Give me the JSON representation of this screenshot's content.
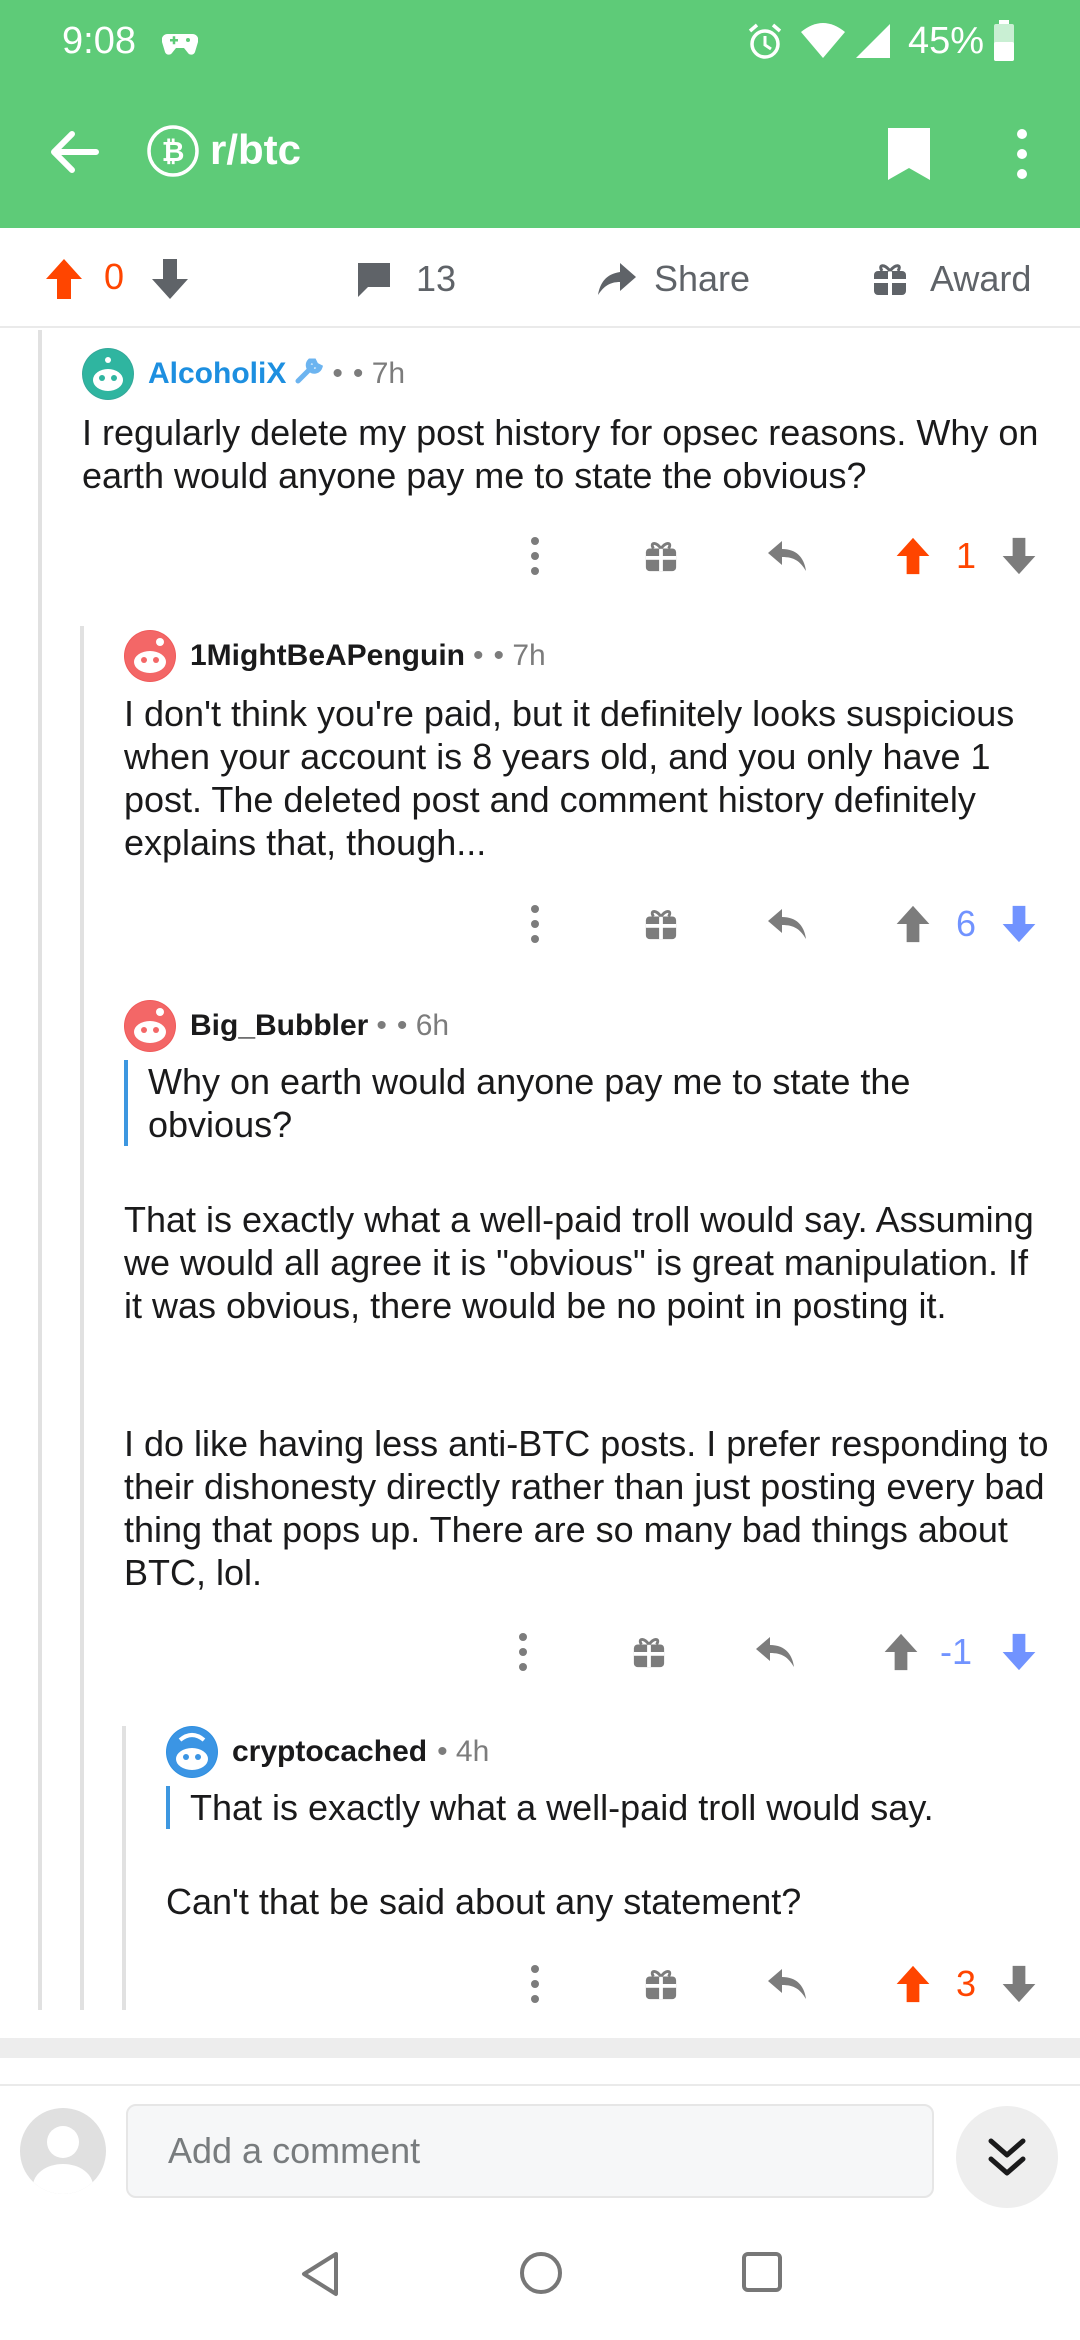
{
  "status_bar": {
    "time": "9:08",
    "battery": "45%"
  },
  "app_bar": {
    "subreddit": "r/btc"
  },
  "action_bar": {
    "score": "0",
    "comments_count": "13",
    "share_label": "Share",
    "award_label": "Award"
  },
  "comments": [
    {
      "author": "AlcoholiX",
      "separator": "•",
      "age": "• 7h",
      "body": "I regularly delete my post history for opsec reasons. Why on earth would anyone pay me to state the obvious?",
      "score": "1"
    },
    {
      "author": "1MightBeAPenguin",
      "separator": "•",
      "age": "• 7h",
      "body": "I don't think you're paid, but it definitely looks suspicious when your account is 8 years old, and you only have 1 post. The deleted post and comment history definitely explains that, though...",
      "score": "6"
    },
    {
      "author": "Big_Bubbler",
      "separator": "•",
      "age": "• 6h",
      "quote": "Why on earth would anyone pay me to state the obvious?",
      "para1": "That is exactly what a well-paid troll would say. Assuming we would all agree it is \"obvious\" is great manipulation. If it was obvious, there would be no point in posting it.",
      "para2": "I do like having less anti-BTC posts. I prefer responding to their dishonesty directly rather than just posting every bad thing that pops up. There are so many bad things about BTC, lol.",
      "score": "-1"
    },
    {
      "author": "cryptocached",
      "age": "• 4h",
      "quote": "That is exactly what a well-paid troll would say.",
      "para1": "Can't that be said about any statement?",
      "score": "3"
    }
  ],
  "composer": {
    "placeholder": "Add a comment"
  },
  "colors": {
    "header_green": "#5ecb78",
    "upvote": "#ff4500",
    "downvote": "#7193ff",
    "quote_bar": "#3d97e0"
  }
}
